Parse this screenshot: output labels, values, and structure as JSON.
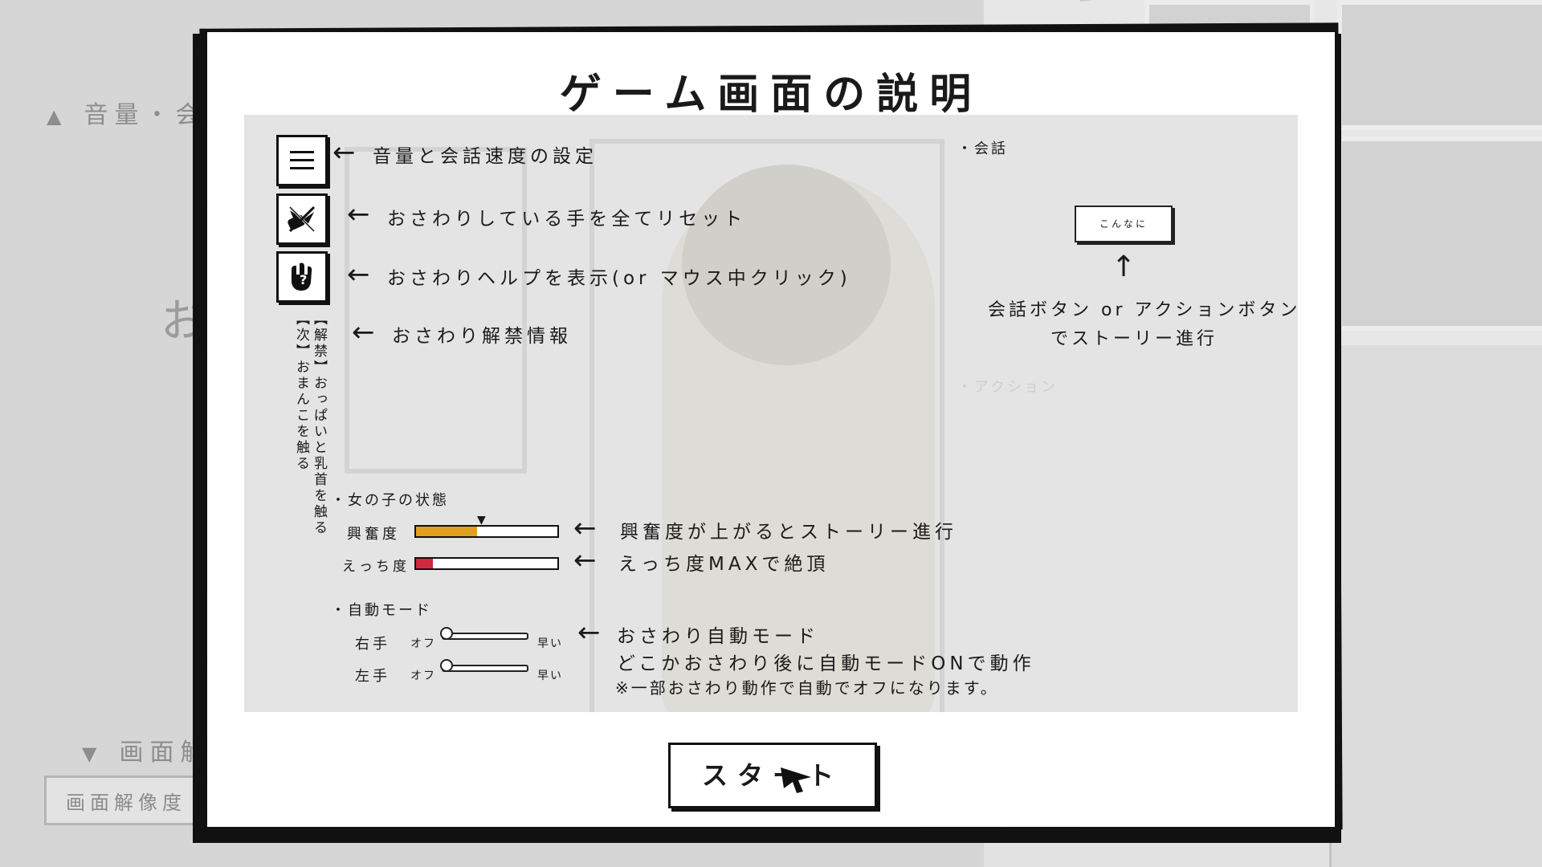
{
  "background": {
    "volume_section": "音量・会話",
    "volume_arrow": "▲",
    "big_glyph": "お",
    "resolution_section": "画面解",
    "resolution_arrow": "▼",
    "resolution_value": "画面解像度"
  },
  "dialog": {
    "title": "ゲーム画面の説明",
    "icons": [
      "menu-icon",
      "reset-hands-icon",
      "touch-help-icon"
    ],
    "help_lines": {
      "volume": "音量と会話速度の設定",
      "reset": "おさわりしている手を全てリセット",
      "help": "おさわりヘルプを表示(or マウス中クリック)",
      "unlock": "おさわり解禁情報"
    },
    "unlock_info": {
      "line1": "【解禁】おっぱいと乳首を触る",
      "line2": "【次】おまんこを触る"
    },
    "girl_status": {
      "section": "・女の子の状態",
      "excitement_label": "興奮度",
      "excitement_value": 0.43,
      "excitement_color": "#e0a020",
      "ecchi_label": "えっち度",
      "ecchi_value": 0.12,
      "ecchi_color": "#d0283c",
      "excitement_note": "興奮度が上がるとストーリー進行",
      "ecchi_note": "えっち度MAXで絶頂"
    },
    "auto_mode": {
      "section": "・自動モード",
      "right_label": "右手",
      "left_label": "左手",
      "off_label": "オフ",
      "fast_label": "早い",
      "note1": "おさわり自動モード",
      "note2": "どこかおさわり後に自動モードONで動作",
      "note3": "※一部おさわり動作で自動でオフになります。"
    },
    "conversation": {
      "section": "・会話",
      "sample_button": "こんなに",
      "up_arrow": "↑",
      "note_line1": "会話ボタン or アクションボタン",
      "note_line2": "でストーリー進行",
      "action_section": "・アクション"
    },
    "start_button": "スタート",
    "left_arrow": "←"
  }
}
